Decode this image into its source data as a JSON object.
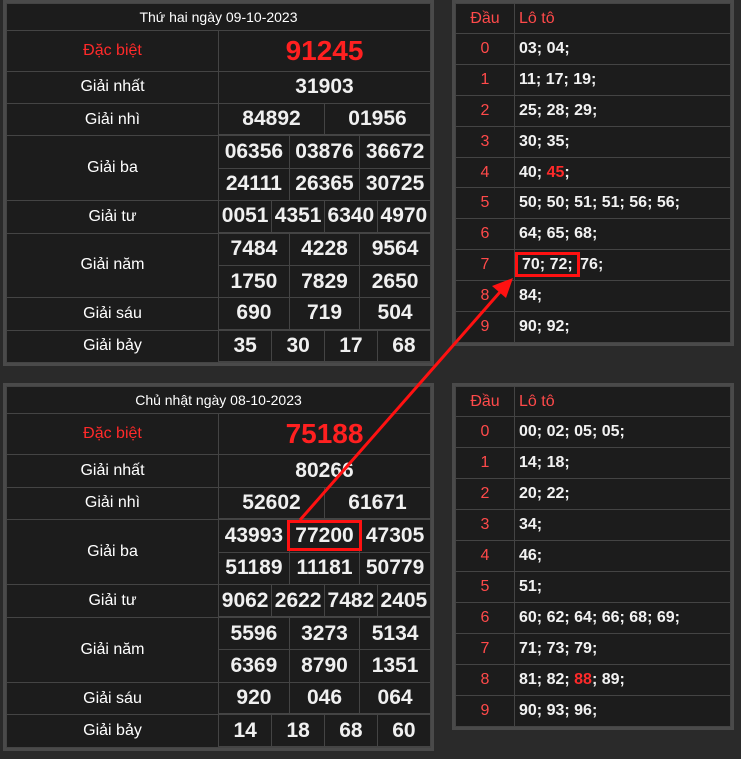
{
  "day1": {
    "title": "Thứ hai ngày 09-10-2023",
    "labels": {
      "db": "Đặc biệt",
      "g1": "Giải nhất",
      "g2": "Giải nhì",
      "g3": "Giải ba",
      "g4": "Giải tư",
      "g5": "Giải năm",
      "g6": "Giải sáu",
      "g7": "Giải bảy"
    },
    "db": "91245",
    "g1": "31903",
    "g2": [
      "84892",
      "01956"
    ],
    "g3": [
      "06356",
      "03876",
      "36672",
      "24111",
      "26365",
      "30725"
    ],
    "g4": [
      "0051",
      "4351",
      "6340",
      "4970"
    ],
    "g5": [
      "7484",
      "4228",
      "9564",
      "1750",
      "7829",
      "2650"
    ],
    "g6": [
      "690",
      "719",
      "504"
    ],
    "g7": [
      "35",
      "30",
      "17",
      "68"
    ]
  },
  "day2": {
    "title": "Chủ nhật ngày 08-10-2023",
    "labels": {
      "db": "Đặc biệt",
      "g1": "Giải nhất",
      "g2": "Giải nhì",
      "g3": "Giải ba",
      "g4": "Giải tư",
      "g5": "Giải năm",
      "g6": "Giải sáu",
      "g7": "Giải bảy"
    },
    "db": "75188",
    "g1": "80266",
    "g2": [
      "52602",
      "61671"
    ],
    "g3": [
      "43993",
      "77200",
      "47305",
      "51189",
      "11181",
      "50779"
    ],
    "g4": [
      "9062",
      "2622",
      "7482",
      "2405"
    ],
    "g5": [
      "5596",
      "3273",
      "5134",
      "6369",
      "8790",
      "1351"
    ],
    "g6": [
      "920",
      "046",
      "064"
    ],
    "g7": [
      "14",
      "18",
      "68",
      "60"
    ]
  },
  "loto1": {
    "h1": "Đầu",
    "h2": "Lô tô",
    "rows": [
      {
        "d": "0",
        "v": "03; 04;"
      },
      {
        "d": "1",
        "v": "11; 17; 19;"
      },
      {
        "d": "2",
        "v": "25; 28; 29;"
      },
      {
        "d": "3",
        "v": "30; 35;"
      },
      {
        "d": "4",
        "a": "40; ",
        "r": "45",
        "b": ";"
      },
      {
        "d": "5",
        "v": "50; 50; 51; 51; 56; 56;"
      },
      {
        "d": "6",
        "v": "64; 65; 68;"
      },
      {
        "d": "7",
        "hl": "70; 72;",
        "b": " 76;"
      },
      {
        "d": "8",
        "v": "84;"
      },
      {
        "d": "9",
        "v": "90; 92;"
      }
    ]
  },
  "loto2": {
    "h1": "Đầu",
    "h2": "Lô tô",
    "rows": [
      {
        "d": "0",
        "v": "00; 02; 05; 05;"
      },
      {
        "d": "1",
        "v": "14; 18;"
      },
      {
        "d": "2",
        "v": "20; 22;"
      },
      {
        "d": "3",
        "v": "34;"
      },
      {
        "d": "4",
        "v": "46;"
      },
      {
        "d": "5",
        "v": "51;"
      },
      {
        "d": "6",
        "v": "60; 62; 64; 66; 68; 69;"
      },
      {
        "d": "7",
        "v": "71; 73; 79;"
      },
      {
        "d": "8",
        "a": "81; 82; ",
        "r": "88",
        "b": "; 89;"
      },
      {
        "d": "9",
        "v": "90; 93; 96;"
      }
    ]
  },
  "colors": {
    "accent": "#ff2020",
    "annotation": "#ff1111"
  }
}
